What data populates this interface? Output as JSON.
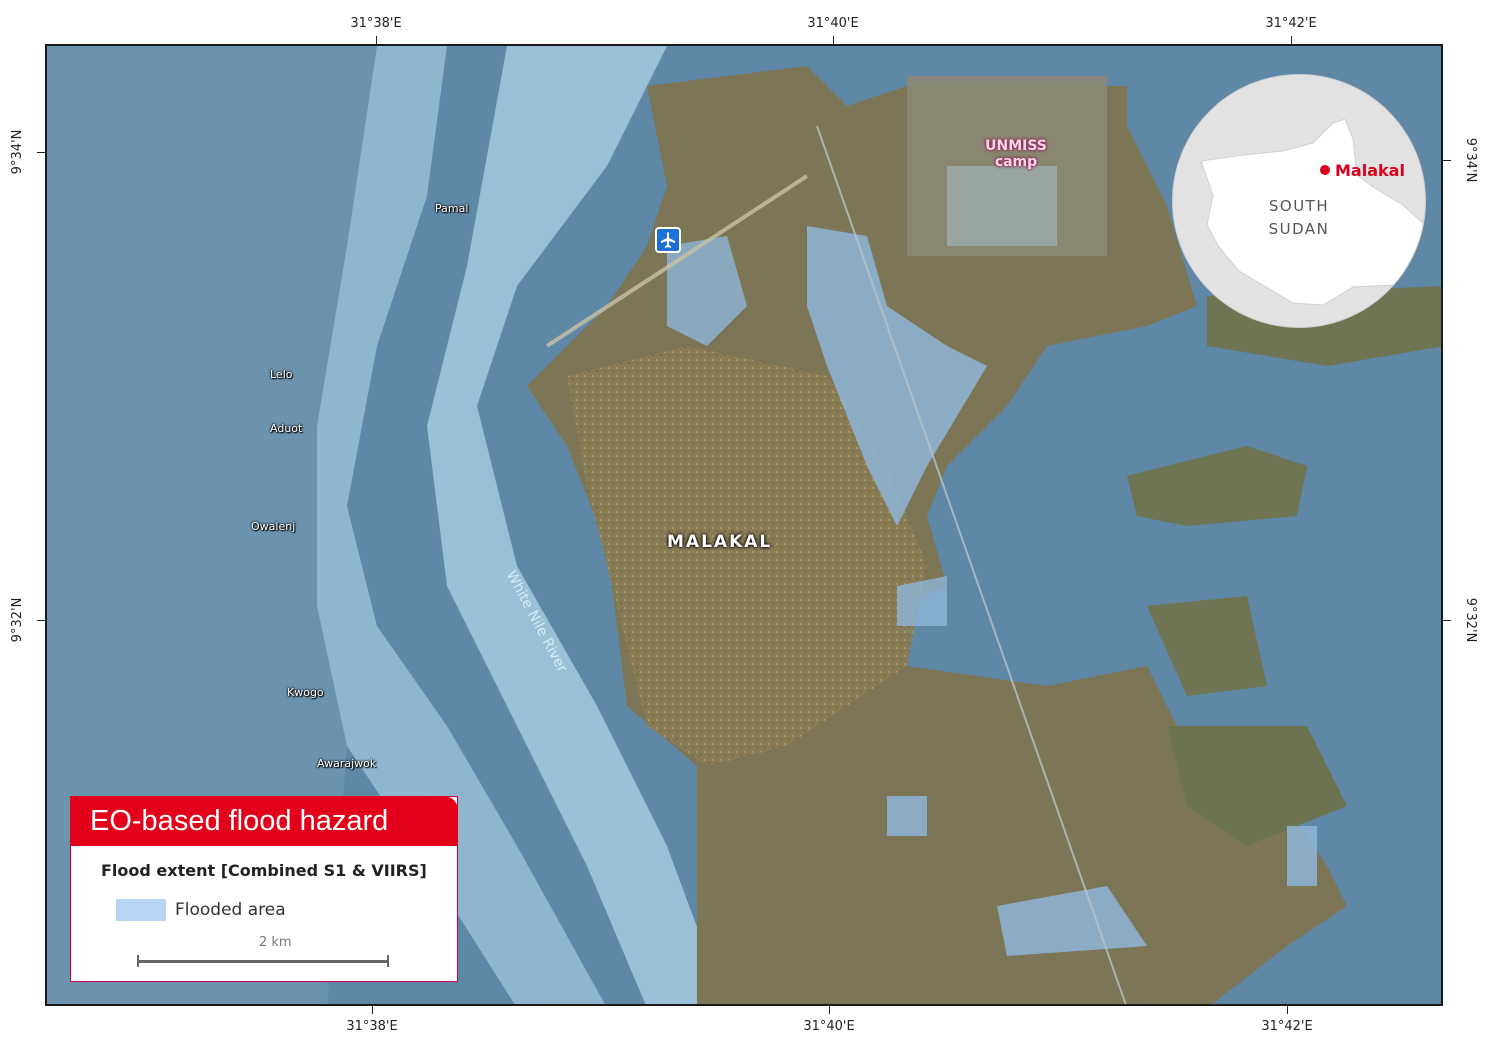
{
  "graticule": {
    "top": [
      "31°38'E",
      "31°40'E",
      "31°42'E"
    ],
    "bottom": [
      "31°38'E",
      "31°40'E",
      "31°42'E"
    ],
    "left": [
      "9°34'N",
      "9°32'N"
    ],
    "right": [
      "9°34'N",
      "9°32'N"
    ]
  },
  "places": {
    "pamal": "Pamal",
    "lelo": "Lelo",
    "aduot": "Aduot",
    "owalenj": "Owalenj",
    "kwogo": "Kwogo",
    "awarajwok": "Awarajwok",
    "city": "MALAKAL",
    "camp_line1": "UNMISS",
    "camp_line2": "camp",
    "river": "White Nile River"
  },
  "inset": {
    "country_line1": "SOUTH",
    "country_line2": "SUDAN",
    "city": "Malakal",
    "marker_color": "#d9001e"
  },
  "legend": {
    "title": "EO-based flood hazard",
    "subtitle": "Flood extent [Combined S1 & VIIRS]",
    "item_label": "Flooded area",
    "item_color": "#b7d4f4",
    "scale_label": "2 km"
  },
  "colors": {
    "brand_red": "#e2001a",
    "flood": "#8fb6d8",
    "land": "#7a7350"
  },
  "icons": {
    "airport": "airplane-icon",
    "city_marker": "location-dot-icon"
  }
}
